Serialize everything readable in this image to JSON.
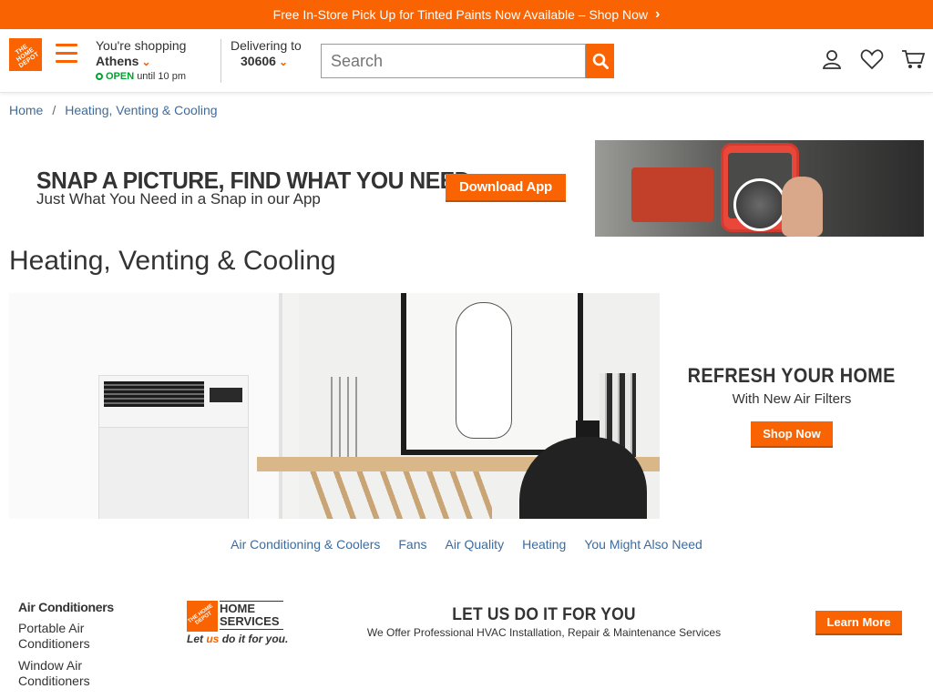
{
  "colors": {
    "brand_orange": "#f96302",
    "link_blue": "#3d6b9e",
    "open_green": "#00a330"
  },
  "promo": {
    "text": "Free In-Store Pick Up for Tinted Paints Now Available – Shop Now",
    "chevron": "›"
  },
  "header": {
    "logo_text": "THE HOME DEPOT",
    "store": {
      "label": "You're shopping",
      "name": "Athens",
      "status": "OPEN",
      "hours": "until 10 pm"
    },
    "delivery": {
      "label": "Delivering to",
      "zip": "30606"
    },
    "search": {
      "placeholder": "Search"
    },
    "icons": [
      "account-icon",
      "heart-icon",
      "cart-icon"
    ]
  },
  "breadcrumb": {
    "items": [
      "Home",
      "Heating, Venting & Cooling"
    ],
    "separator": "/"
  },
  "app_banner": {
    "headline": "SNAP A PICTURE, FIND WHAT YOU NEED",
    "subline": "Just What You Need in a Snap in our App",
    "button": "Download App"
  },
  "page_title": "Heating, Venting & Cooling",
  "hero": {
    "headline": "REFRESH YOUR HOME",
    "subline": "With New Air Filters",
    "button": "Shop Now"
  },
  "category_nav": [
    "Air Conditioning & Coolers",
    "Fans",
    "Air Quality",
    "Heating",
    "You Might Also Need"
  ],
  "sidebar": {
    "heading": "Air Conditioners",
    "items": [
      "Portable Air Conditioners",
      "Window Air Conditioners"
    ]
  },
  "services_banner": {
    "brand_line1": "HOME",
    "brand_line2": "SERVICES",
    "tag_prefix": "Let ",
    "tag_us": "us",
    "tag_suffix": " do it for you.",
    "headline": "LET US DO IT FOR YOU",
    "subline": "We Offer Professional HVAC Installation, Repair & Maintenance Services",
    "button": "Learn More"
  }
}
